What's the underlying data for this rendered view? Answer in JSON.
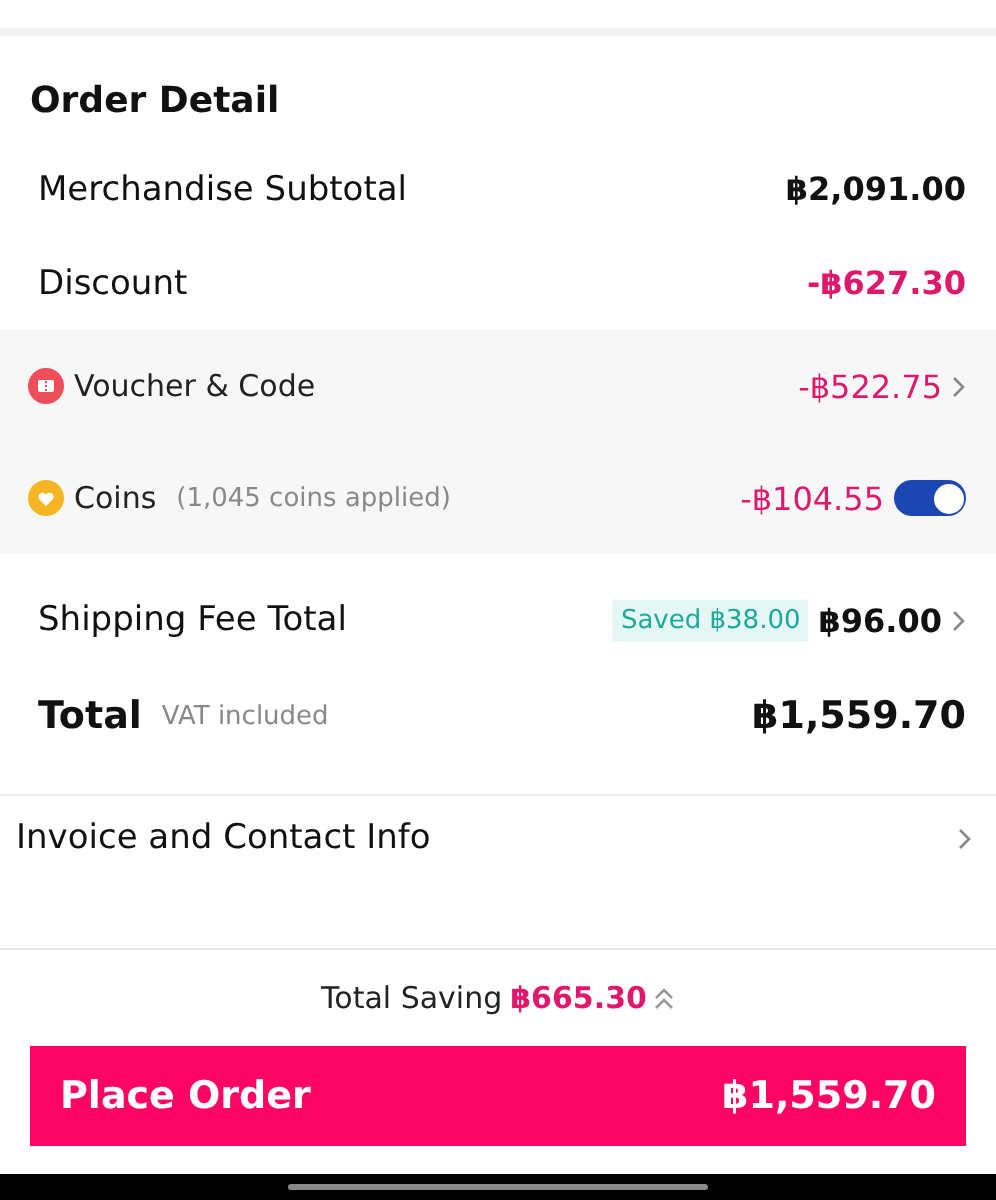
{
  "order_detail": {
    "title": "Order Detail",
    "merchandise": {
      "label": "Merchandise Subtotal",
      "amount": "฿2,091.00"
    },
    "discount": {
      "label": "Discount",
      "amount": "-฿627.30"
    },
    "discount_items": [
      {
        "kind": "voucher",
        "label": "Voucher & Code",
        "amount": "-฿522.75"
      },
      {
        "kind": "coins",
        "label": "Coins",
        "note": "(1,045 coins applied)",
        "amount": "-฿104.55",
        "on": true
      }
    ],
    "shipping": {
      "label": "Shipping Fee Total",
      "badge": "Saved ฿38.00",
      "amount": "฿96.00"
    },
    "total": {
      "label": "Total",
      "note": "VAT included",
      "amount": "฿1,559.70"
    }
  },
  "invoice": {
    "label": "Invoice and Contact Info"
  },
  "footer": {
    "saving_label": "Total Saving",
    "saving_amount": "฿665.30",
    "button_label": "Place Order",
    "button_amount": "฿1,559.70"
  }
}
